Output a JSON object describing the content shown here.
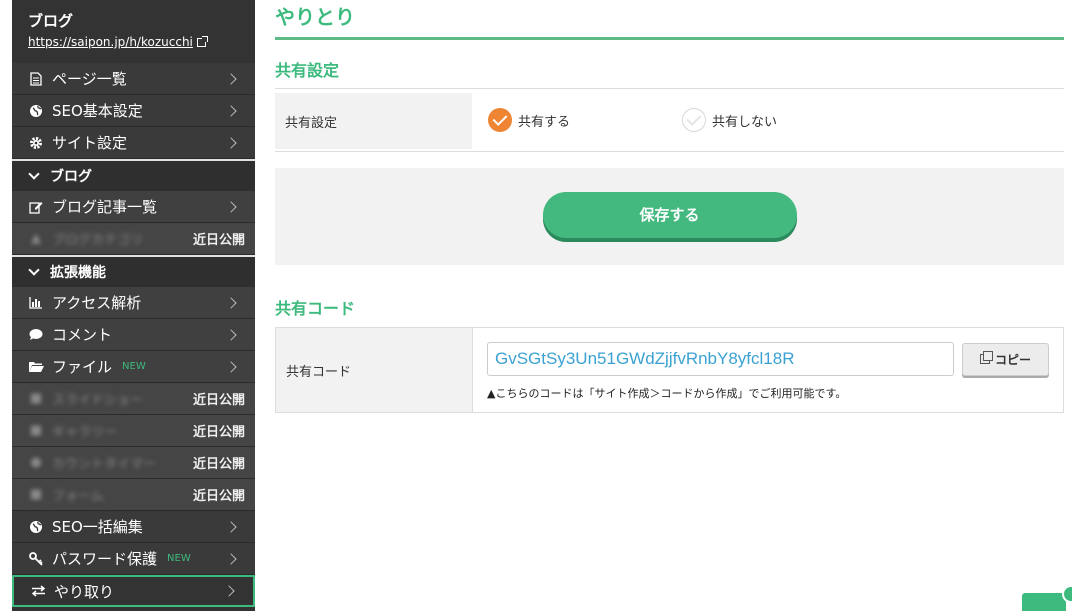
{
  "sidebar": {
    "blog_title": "ブログ",
    "blog_url": "https://saipon.jp/h/kozucchi",
    "top_items": [
      {
        "label": "ページ一覧",
        "icon": "document-icon"
      },
      {
        "label": "SEO基本設定",
        "icon": "globe-icon"
      },
      {
        "label": "サイト設定",
        "icon": "gear-icon"
      }
    ],
    "section_blog": "ブログ",
    "blog_items": [
      {
        "label": "ブログ記事一覧",
        "icon": "edit-icon"
      }
    ],
    "blog_soon": [
      {
        "label": "ブログカテゴリ",
        "tag": "近日公開"
      }
    ],
    "section_ext": "拡張機能",
    "ext_items": [
      {
        "label": "アクセス解析",
        "icon": "bar-chart-icon"
      },
      {
        "label": "コメント",
        "icon": "speech-bubble-icon"
      },
      {
        "label": "ファイル",
        "icon": "folder-icon",
        "badge": "NEW"
      }
    ],
    "ext_soon": [
      {
        "label": "スライドショー",
        "tag": "近日公開"
      },
      {
        "label": "ギャラリー",
        "tag": "近日公開"
      },
      {
        "label": "カウントタイマー",
        "tag": "近日公開"
      },
      {
        "label": "フォーム",
        "tag": "近日公開"
      }
    ],
    "bottom_items": [
      {
        "label": "SEO一括編集",
        "icon": "globe-icon"
      },
      {
        "label": "パスワード保護",
        "icon": "key-icon",
        "badge": "NEW"
      },
      {
        "label": "やり取り",
        "icon": "swap-arrows-icon"
      }
    ]
  },
  "main": {
    "page_title": "やりとり",
    "share_settings": {
      "section_title": "共有設定",
      "row_label": "共有設定",
      "option_on": "共有する",
      "option_off": "共有しない",
      "selected": "共有する"
    },
    "save_label": "保存する",
    "share_code": {
      "section_title": "共有コード",
      "row_label": "共有コード",
      "value": "GvSGtSy3Un51GWdZjjfvRnbY8yfcl18R",
      "copy_label": "コピー",
      "note": "▲こちらのコードは「サイト作成＞コードから作成」でご利用可能です。"
    }
  },
  "colors": {
    "accent_green": "#3dba7d",
    "sidebar_bg": "#333333",
    "selected_orange": "#ef8432",
    "code_text": "#3aa2d2"
  }
}
